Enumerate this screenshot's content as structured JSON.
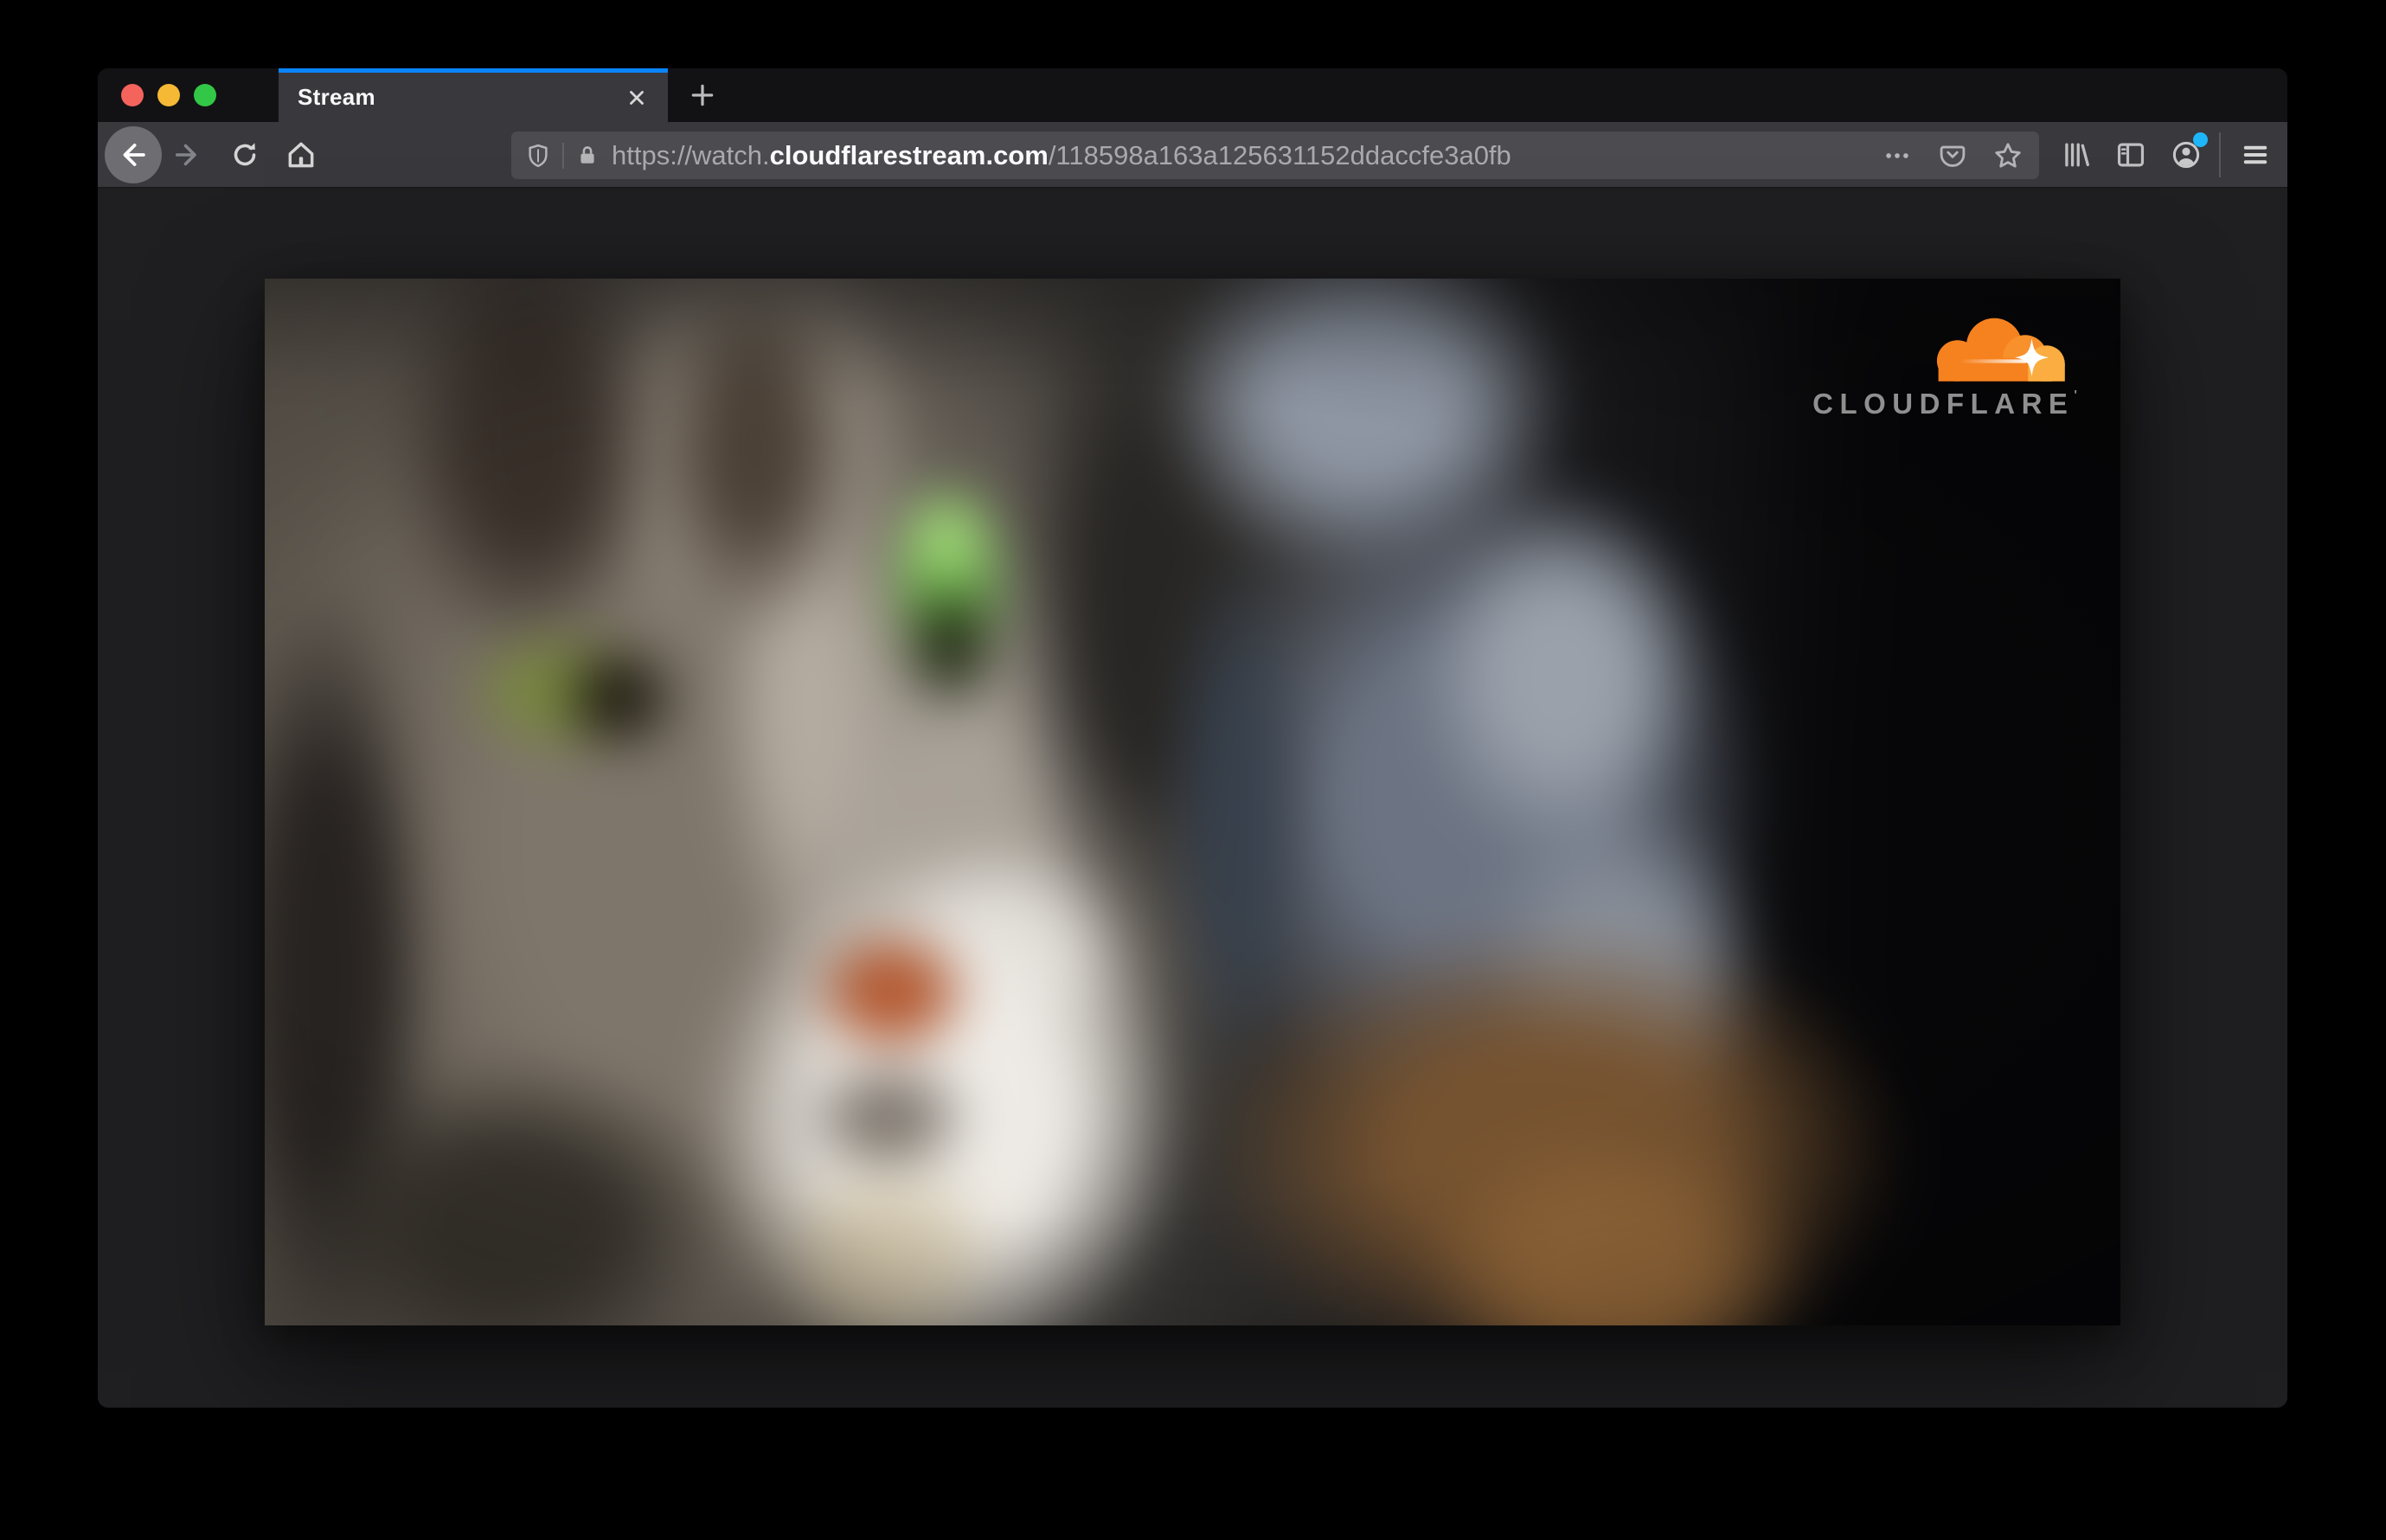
{
  "browser": {
    "window_controls": {
      "close_label": "close",
      "minimize_label": "minimize",
      "zoom_label": "zoom"
    },
    "tab_bar": {
      "active_tab_title": "Stream"
    },
    "url_bar": {
      "url_prefix": "https://watch.",
      "url_domain": "cloudflarestream.com",
      "url_path": "/118598a163a125631152ddaccfe3a0fb"
    }
  },
  "page": {
    "video_watermark_brand": "CLOUDFLARE",
    "video_watermark_tm": "'"
  },
  "colors": {
    "active_tab_accent": "#0a84ff",
    "toolbar_background": "#38383d",
    "urlbar_background": "#4b4b50",
    "cloudflare_orange": "#f6821f",
    "cloudflare_light_orange": "#fbad41",
    "account_badge_blue": "#1fb6f9",
    "traffic_close": "#f4645c",
    "traffic_minimize": "#f5b935",
    "traffic_zoom": "#32c746"
  }
}
